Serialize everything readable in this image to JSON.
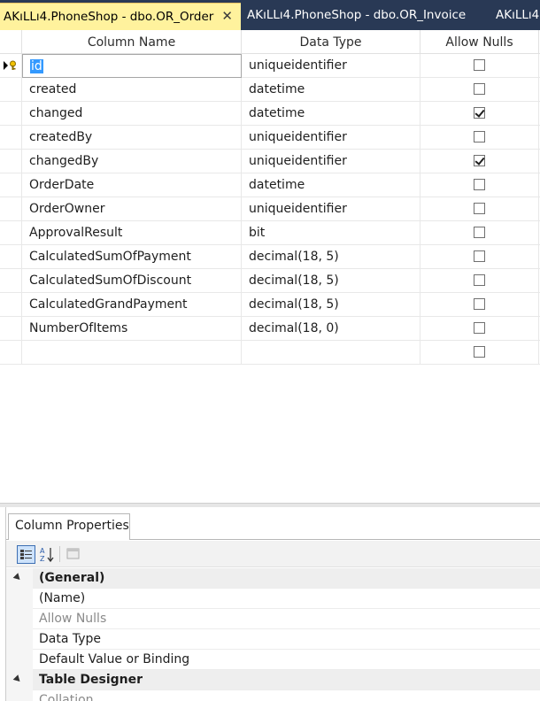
{
  "tabs": [
    {
      "label": "AKıLLı4.PhoneShop - dbo.OR_Order",
      "active": true,
      "close_glyph": "✕"
    },
    {
      "label": "AKıLLı4.PhoneShop - dbo.OR_Invoice",
      "active": false
    },
    {
      "label": "AKıLLı4",
      "active": false
    }
  ],
  "grid": {
    "headers": {
      "column_name": "Column Name",
      "data_type": "Data Type",
      "allow_nulls": "Allow Nulls"
    },
    "rows": [
      {
        "name": "id",
        "type": "uniqueidentifier",
        "allow_nulls": false,
        "primary_key": true
      },
      {
        "name": "created",
        "type": "datetime",
        "allow_nulls": false
      },
      {
        "name": "changed",
        "type": "datetime",
        "allow_nulls": true
      },
      {
        "name": "createdBy",
        "type": "uniqueidentifier",
        "allow_nulls": false
      },
      {
        "name": "changedBy",
        "type": "uniqueidentifier",
        "allow_nulls": true
      },
      {
        "name": "OrderDate",
        "type": "datetime",
        "allow_nulls": false
      },
      {
        "name": "OrderOwner",
        "type": "uniqueidentifier",
        "allow_nulls": false
      },
      {
        "name": "ApprovalResult",
        "type": "bit",
        "allow_nulls": false
      },
      {
        "name": "CalculatedSumOfPayment",
        "type": "decimal(18, 5)",
        "allow_nulls": false
      },
      {
        "name": "CalculatedSumOfDiscount",
        "type": "decimal(18, 5)",
        "allow_nulls": false
      },
      {
        "name": "CalculatedGrandPayment",
        "type": "decimal(18, 5)",
        "allow_nulls": false
      },
      {
        "name": "NumberOfItems",
        "type": "decimal(18, 0)",
        "allow_nulls": false
      },
      {
        "name": "",
        "type": "",
        "allow_nulls": false
      }
    ]
  },
  "properties": {
    "tab_label": "Column Properties",
    "toolbar": {
      "categorized_icon": "categorized-icon",
      "alphabetical_icon": "sort-alphabetical-icon",
      "property_pages_icon": "property-pages-icon"
    },
    "rows": [
      {
        "label": "(General)",
        "kind": "category"
      },
      {
        "label": "(Name)",
        "kind": "property"
      },
      {
        "label": "Allow Nulls",
        "kind": "disabled"
      },
      {
        "label": "Data Type",
        "kind": "property"
      },
      {
        "label": "Default Value or Binding",
        "kind": "property"
      },
      {
        "label": "Table Designer",
        "kind": "category"
      },
      {
        "label": "Collation",
        "kind": "disabled"
      }
    ]
  },
  "colors": {
    "tabstrip_bg": "#293955",
    "active_tab_bg": "#fff29d",
    "selection_bg": "#3399ff"
  }
}
